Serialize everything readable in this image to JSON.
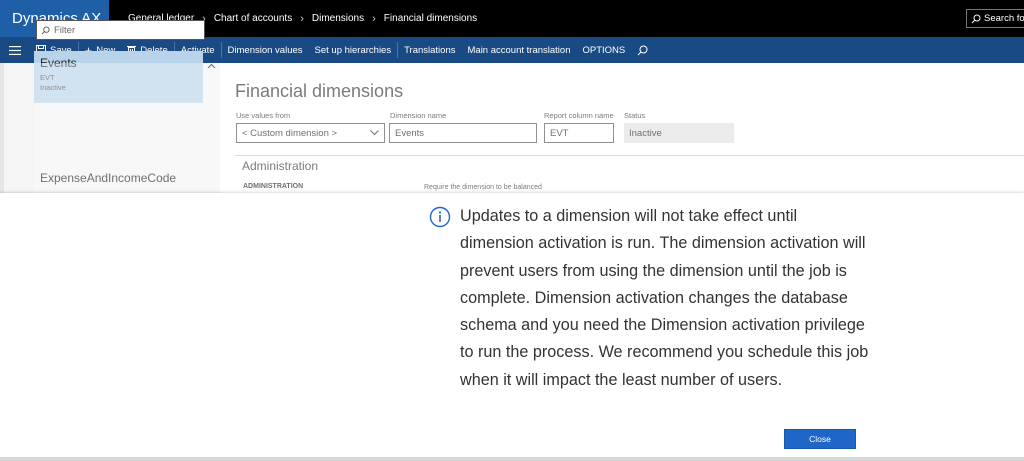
{
  "app": {
    "title": "Dynamics AX"
  },
  "breadcrumb": [
    "General ledger",
    "Chart of accounts",
    "Dimensions",
    "Financial dimensions"
  ],
  "search": {
    "placeholder": "Search fo"
  },
  "actionpane": {
    "save": "Save",
    "new": "New",
    "delete": "Delete",
    "activate": "Activate",
    "dimension_values": "Dimension values",
    "setup_hierarchies": "Set up hierarchies",
    "translations": "Translations",
    "main_account_translation": "Main account translation",
    "options": "OPTIONS"
  },
  "list": {
    "filter_placeholder": "Filter",
    "selected": {
      "name": "Events",
      "code": "EVT",
      "status": "Inactive"
    },
    "items": [
      "ExpenseAndIncomeCode"
    ]
  },
  "form": {
    "title": "Financial dimensions",
    "use_values_from_label": "Use values from",
    "use_values_from_value": "< Custom dimension >",
    "dimension_name_label": "Dimension name",
    "dimension_name_value": "Events",
    "report_column_label": "Report column name",
    "report_column_value": "EVT",
    "status_label": "Status",
    "status_value": "Inactive",
    "section_title": "Administration",
    "subsection_title": "ADMINISTRATION",
    "balance_label": "Require the dimension to be balanced"
  },
  "dialog": {
    "message": "Updates to a dimension will not take effect until dimension activation is run. The dimension activation will prevent users from using the dimension until the job is complete. Dimension activation changes the database schema and you need the Dimension activation privilege to run the process. We recommend you schedule this job when it will impact the least number of users.",
    "close_label": "Close"
  },
  "colors": {
    "brand": "#1f5fa8",
    "actionpane": "#1a4a84",
    "selected_item": "#b8d3ea",
    "primary_button": "#1f66c7"
  },
  "icons": [
    "menu-icon",
    "save-icon",
    "plus-icon",
    "trash-icon",
    "search-icon",
    "info-icon",
    "chevron-down-icon",
    "chevron-right-icon"
  ]
}
